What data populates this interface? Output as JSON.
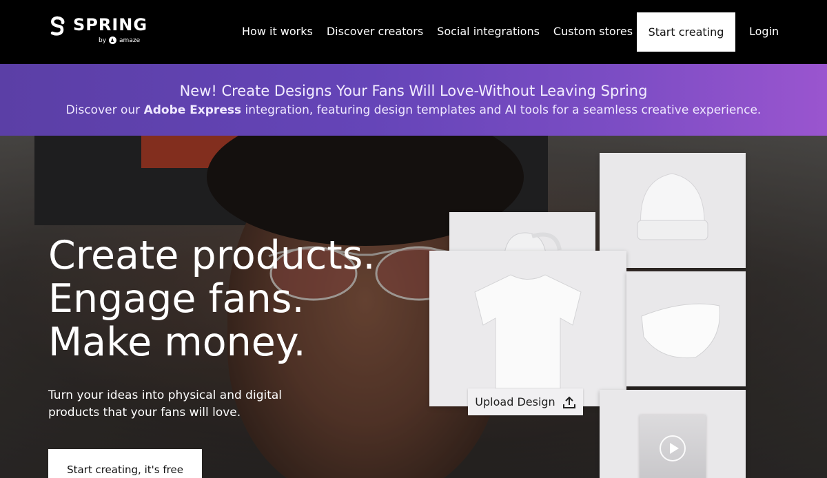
{
  "brand": {
    "name": "SPRING",
    "by": "by",
    "partner": "amaze"
  },
  "nav": {
    "links": [
      "How it works",
      "Discover creators",
      "Social integrations",
      "Custom stores"
    ],
    "cta": "Start creating",
    "login": "Login"
  },
  "banner": {
    "title": "New! Create Designs Your Fans Will Love-Without Leaving Spring",
    "sub_prefix": "Discover our",
    "sub_bold": "Adobe Express",
    "sub_suffix": "integration, featuring design templates and AI tools for a seamless creative experience."
  },
  "hero": {
    "headline": [
      "Create products.",
      "Engage fans.",
      "Make money."
    ],
    "subcopy": "Turn your ideas into physical and digital products that your fans will love.",
    "cta": "Start creating, it's free"
  },
  "products": {
    "upload_label": "Upload Design",
    "items": [
      "beanie",
      "backpack",
      "t-shirt",
      "face-mask",
      "video"
    ]
  },
  "colors": {
    "banner_start": "#5b3fa6",
    "banner_end": "#9a55cf",
    "nav_bg": "#000000"
  }
}
